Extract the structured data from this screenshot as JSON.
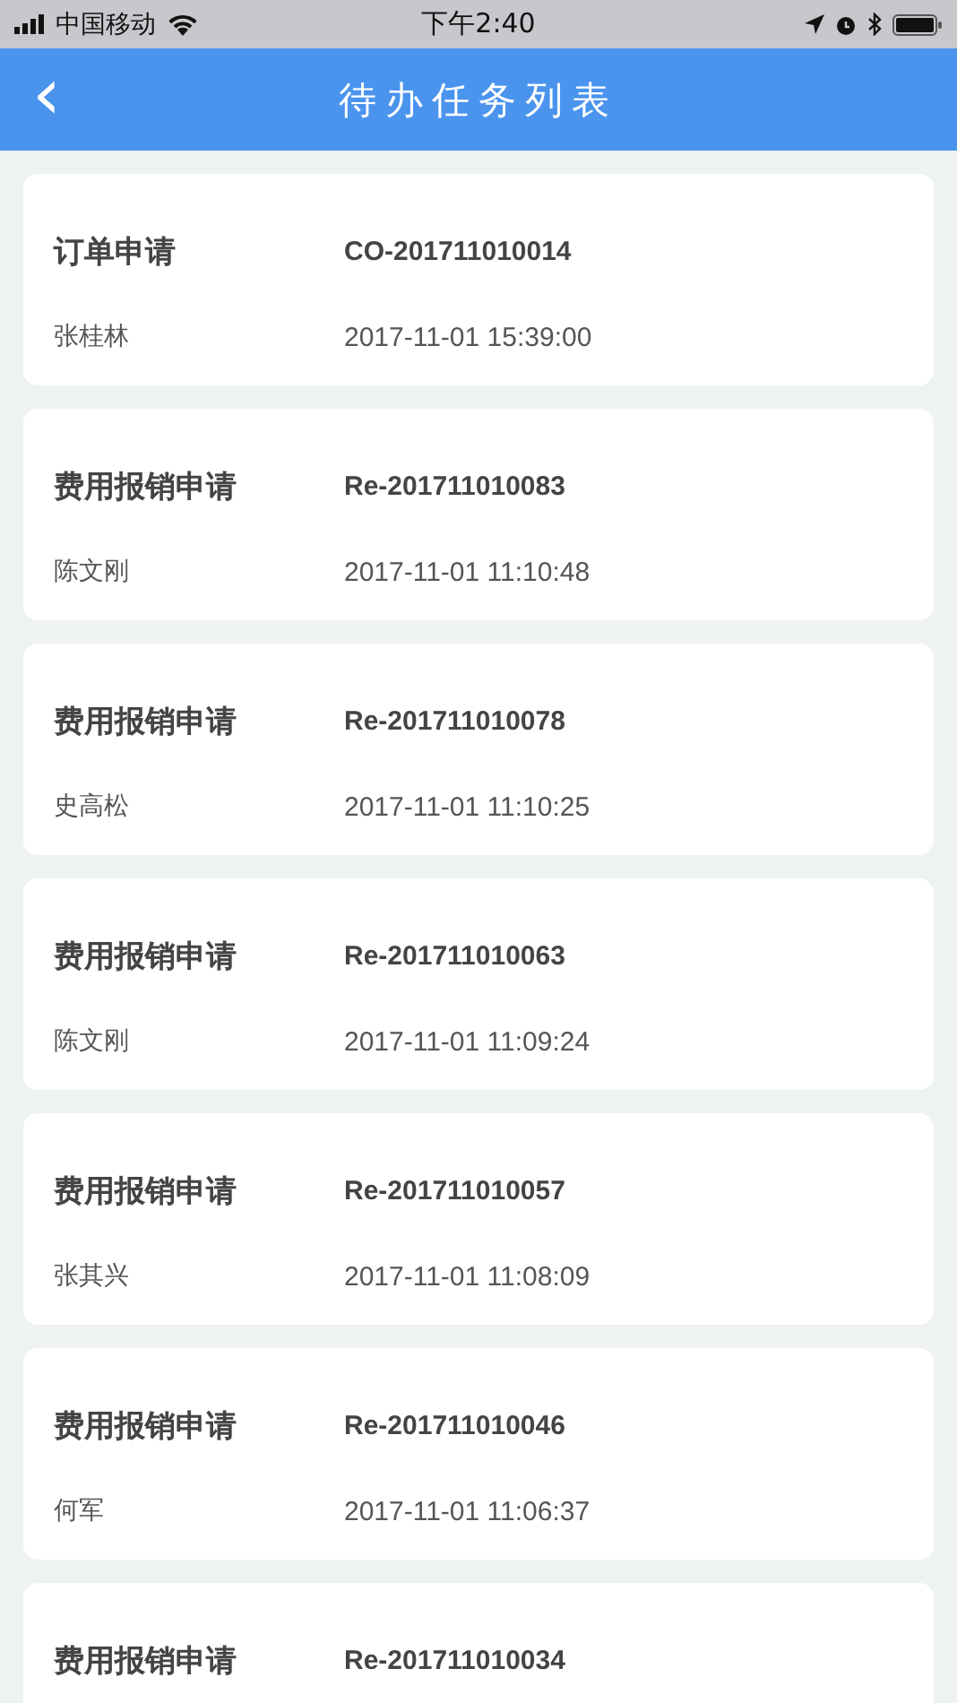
{
  "status_bar": {
    "carrier": "中国移动",
    "time": "下午2:40"
  },
  "header": {
    "back": "‹",
    "title": "待办任务列表"
  },
  "tasks": [
    {
      "type": "订单申请",
      "code": "CO-201711010014",
      "name": "张桂林",
      "time": "2017-11-01 15:39:00"
    },
    {
      "type": "费用报销申请",
      "code": "Re-201711010083",
      "name": "陈文刚",
      "time": "2017-11-01 11:10:48"
    },
    {
      "type": "费用报销申请",
      "code": "Re-201711010078",
      "name": "史高松",
      "time": "2017-11-01 11:10:25"
    },
    {
      "type": "费用报销申请",
      "code": "Re-201711010063",
      "name": "陈文刚",
      "time": "2017-11-01 11:09:24"
    },
    {
      "type": "费用报销申请",
      "code": "Re-201711010057",
      "name": "张其兴",
      "time": "2017-11-01 11:08:09"
    },
    {
      "type": "费用报销申请",
      "code": "Re-201711010046",
      "name": "何军",
      "time": "2017-11-01 11:06:37"
    },
    {
      "type": "费用报销申请",
      "code": "Re-201711010034"
    }
  ]
}
